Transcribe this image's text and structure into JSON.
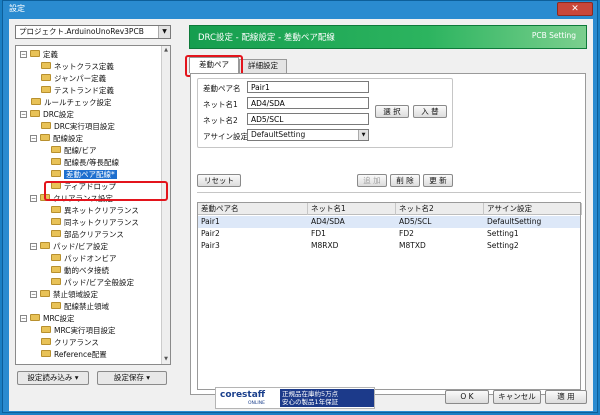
{
  "window": {
    "title": "設定",
    "close_label": "✕"
  },
  "left": {
    "project_select": "プロジェクト.ArduinoUnoRev3PCB",
    "tree": [
      {
        "label": "定義",
        "expander": "−",
        "level": 0,
        "icon": "folder-icon"
      },
      {
        "label": "ネットクラス定義",
        "level": 1,
        "icon": "folder-icon"
      },
      {
        "label": "ジャンパー定義",
        "level": 1,
        "icon": "folder-icon"
      },
      {
        "label": "テストランド定義",
        "level": 1,
        "icon": "folder-icon"
      },
      {
        "label": "ルールチェック設定",
        "level": 0,
        "icon": "folder-icon"
      },
      {
        "label": "DRC設定",
        "expander": "−",
        "level": 0,
        "icon": "folder-icon"
      },
      {
        "label": "DRC実行項目設定",
        "level": 1,
        "icon": "folder-icon"
      },
      {
        "label": "配線設定",
        "expander": "−",
        "level": 1,
        "icon": "folder-icon"
      },
      {
        "label": "配線/ビア",
        "level": 2,
        "icon": "folder-icon"
      },
      {
        "label": "配線長/等長配線",
        "level": 2,
        "icon": "folder-icon"
      },
      {
        "label": "差動ペア配線*",
        "level": 2,
        "icon": "folder-icon",
        "selected": true
      },
      {
        "label": "ティアドロップ",
        "level": 2,
        "icon": "folder-icon"
      },
      {
        "label": "クリアランス設定",
        "expander": "−",
        "level": 1,
        "icon": "folder-icon"
      },
      {
        "label": "異ネットクリアランス",
        "level": 2,
        "icon": "folder-icon"
      },
      {
        "label": "同ネットクリアランス",
        "level": 2,
        "icon": "folder-icon"
      },
      {
        "label": "部品クリアランス",
        "level": 2,
        "icon": "folder-icon"
      },
      {
        "label": "パッド/ビア設定",
        "expander": "−",
        "level": 1,
        "icon": "folder-icon"
      },
      {
        "label": "パッドオンビア",
        "level": 2,
        "icon": "folder-icon"
      },
      {
        "label": "動的ベタ接続",
        "level": 2,
        "icon": "folder-icon"
      },
      {
        "label": "パッド/ビア全般設定",
        "level": 2,
        "icon": "folder-icon"
      },
      {
        "label": "禁止領域設定",
        "expander": "−",
        "level": 1,
        "icon": "folder-icon"
      },
      {
        "label": "配線禁止領域",
        "level": 2,
        "icon": "folder-icon"
      },
      {
        "label": "MRC設定",
        "expander": "−",
        "level": 0,
        "icon": "folder-icon"
      },
      {
        "label": "MRC実行項目設定",
        "level": 1,
        "icon": "folder-icon"
      },
      {
        "label": "クリアランス",
        "level": 1,
        "icon": "folder-icon"
      },
      {
        "label": "Reference配置",
        "level": 1,
        "icon": "folder-icon"
      }
    ],
    "load_button": "設定読み込み ▾",
    "save_button": "設定保存 ▾"
  },
  "header": {
    "title": "DRC設定 - 配線設定 - 差動ペア配線",
    "brand": "PCB Setting"
  },
  "tabs": [
    {
      "label": "差動ペア",
      "active": true
    },
    {
      "label": "詳細設定",
      "active": false
    }
  ],
  "form": {
    "pair_name_label": "差動ペア名",
    "pair_name_value": "Pair1",
    "net1_label": "ネット名1",
    "net1_value": "AD4/SDA",
    "net2_label": "ネット名2",
    "net2_value": "AD5/SCL",
    "assign_label": "アサイン設定",
    "assign_value": "DefaultSetting",
    "select_button": "選 択",
    "input_button": "入 替",
    "reset_button": "リセット",
    "add_button": "追 加",
    "delete_button": "削 除",
    "update_button": "更 新"
  },
  "table": {
    "columns": [
      "差動ペア名",
      "ネット名1",
      "ネット名2",
      "アサイン設定"
    ],
    "rows": [
      [
        "Pair1",
        "AD4/SDA",
        "AD5/SCL",
        "DefaultSetting"
      ],
      [
        "Pair2",
        "FD1",
        "FD2",
        "Setting1"
      ],
      [
        "Pair3",
        "M8RXD",
        "M8TXD",
        "Setting2"
      ]
    ]
  },
  "banner": {
    "logo": "corestaff",
    "logo_sub": "ONLINE",
    "promo_line1": "正規品在庫約5万点",
    "promo_line2": "安心の製品1年保証"
  },
  "footer": {
    "ok_button": "O K",
    "cancel_button": "キャンセル",
    "apply_button": "適 用"
  },
  "colors": {
    "selection": "#1e6fcf",
    "header_green": "#169e4f",
    "highlight_red": "#e3141c"
  }
}
